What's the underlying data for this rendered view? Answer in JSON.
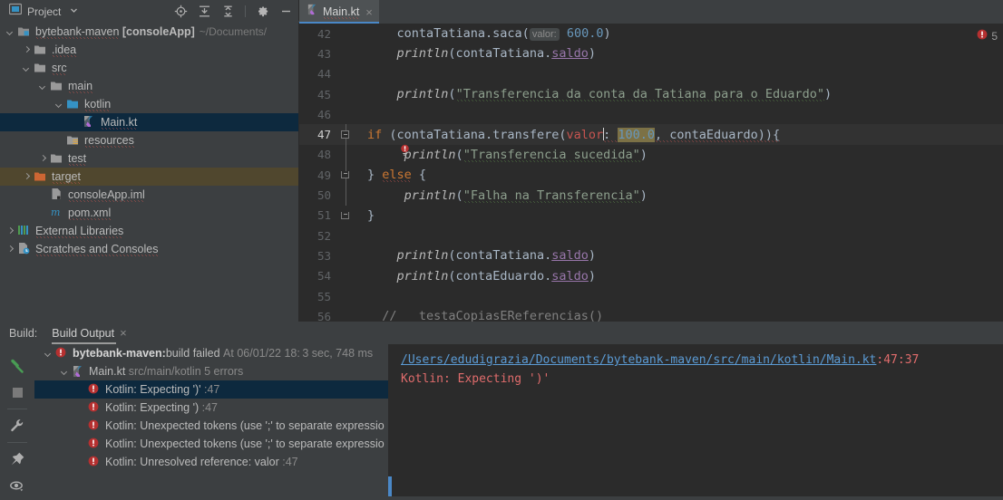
{
  "project_panel": {
    "title": "Project",
    "icons": [
      "project-window-icon",
      "locate-icon",
      "expand-all-icon",
      "collapse-all-icon",
      "settings-gear-icon",
      "minimize-icon"
    ],
    "tree": [
      {
        "indent": 0,
        "arrow": "down",
        "icon": "module-icon",
        "label": "bytebank-maven",
        "bold_suffix": "[consoleApp]",
        "dim": "~/Documents/",
        "state": "normal"
      },
      {
        "indent": 1,
        "arrow": "right",
        "icon": "folder-icon",
        "label": ".idea",
        "bold_suffix": "",
        "dim": "",
        "state": "normal"
      },
      {
        "indent": 1,
        "arrow": "down",
        "icon": "folder-icon",
        "label": "src",
        "bold_suffix": "",
        "dim": "",
        "state": "normal"
      },
      {
        "indent": 2,
        "arrow": "down",
        "icon": "folder-icon",
        "label": "main",
        "bold_suffix": "",
        "dim": "",
        "state": "normal"
      },
      {
        "indent": 3,
        "arrow": "down",
        "icon": "source-root-icon",
        "label": "kotlin",
        "bold_suffix": "",
        "dim": "",
        "state": "normal"
      },
      {
        "indent": 4,
        "arrow": "none",
        "icon": "kotlin-file-icon",
        "label": "Main.kt",
        "bold_suffix": "",
        "dim": "",
        "state": "selected"
      },
      {
        "indent": 3,
        "arrow": "none",
        "icon": "resources-icon",
        "label": "resources",
        "bold_suffix": "",
        "dim": "",
        "state": "normal"
      },
      {
        "indent": 2,
        "arrow": "right",
        "icon": "folder-icon",
        "label": "test",
        "bold_suffix": "",
        "dim": "",
        "state": "normal"
      },
      {
        "indent": 1,
        "arrow": "right",
        "icon": "excluded-folder-icon",
        "label": "target",
        "bold_suffix": "",
        "dim": "",
        "state": "excluded"
      },
      {
        "indent": 2,
        "arrow": "none",
        "icon": "iml-file-icon",
        "label": "consoleApp.iml",
        "bold_suffix": "",
        "dim": "",
        "state": "normal"
      },
      {
        "indent": 2,
        "arrow": "none",
        "icon": "maven-icon",
        "label": "pom.xml",
        "bold_suffix": "",
        "dim": "",
        "state": "normal"
      },
      {
        "indent": 0,
        "arrow": "right",
        "icon": "libraries-icon",
        "label": "External Libraries",
        "bold_suffix": "",
        "dim": "",
        "state": "normal"
      },
      {
        "indent": 0,
        "arrow": "right",
        "icon": "scratches-icon",
        "label": "Scratches and Consoles",
        "bold_suffix": "",
        "dim": "",
        "state": "normal"
      }
    ]
  },
  "editor": {
    "tab": {
      "label": "Main.kt",
      "icon": "kotlin-file-icon",
      "close": "×"
    },
    "error_badge": {
      "icon": "error-icon",
      "count": "5"
    },
    "lines": [
      {
        "n": "42"
      },
      {
        "n": "43"
      },
      {
        "n": "44"
      },
      {
        "n": "45"
      },
      {
        "n": "46"
      },
      {
        "n": "47"
      },
      {
        "n": "48"
      },
      {
        "n": "49"
      },
      {
        "n": "50"
      },
      {
        "n": "51"
      },
      {
        "n": "52"
      },
      {
        "n": "53"
      },
      {
        "n": "54"
      },
      {
        "n": "55"
      },
      {
        "n": "56"
      }
    ],
    "code": {
      "l42_call": "contaTatiana.saca(",
      "l42_hint": "valor:",
      "l42_num": "600.0",
      "l42_close": ")",
      "l43_fn": "println",
      "l43_open": "(contaTatiana.",
      "l43_prop": "saldo",
      "l43_close": ")",
      "l45_fn": "println",
      "l45_open": "(",
      "l45_str": "\"Transferencia da conta da Tatiana para o Eduardo\"",
      "l45_close": ")",
      "l47_kw": "if",
      "l47_a": " (contaTatiana.transfere(",
      "l47_err": "valor",
      "l47_b": ": ",
      "l47_num": "100.0",
      "l47_c": ", contaEduardo)){",
      "l48_fn": "println",
      "l48_open": "(",
      "l48_str": "\"Transferencia sucedida\"",
      "l48_close": ")",
      "l49_a": "} ",
      "l49_kw": "else",
      "l49_b": " {",
      "l50_fn": "println",
      "l50_open": "(",
      "l50_str": "\"Falha na Transferencia\"",
      "l50_close": ")",
      "l51_a": "}",
      "l53_fn": "println",
      "l53_open": "(contaTatiana.",
      "l53_prop": "saldo",
      "l53_close": ")",
      "l54_fn": "println",
      "l54_open": "(contaEduardo.",
      "l54_prop": "saldo",
      "l54_close": ")",
      "l56_cmt_a": "//",
      "l56_cmt_b": "   testaCopiasEReferencias()"
    }
  },
  "build_panel": {
    "label": "Build:",
    "tab": {
      "label": "Build Output",
      "close": "×"
    },
    "side_icons": [
      "build-hammer-icon",
      "stop-icon",
      "toggle-settings-wrench-icon",
      "pin-icon",
      "show-hide-eye-icon"
    ],
    "tree": [
      {
        "indent": 0,
        "arrow": "down",
        "icon": "error-icon",
        "bold": "bytebank-maven:",
        "text": " build failed",
        "dim": "At 06/01/22 18: ",
        "dim2": "3 sec, 748 ms",
        "state": "normal"
      },
      {
        "indent": 1,
        "arrow": "down",
        "icon": "kotlin-file-icon",
        "bold": "",
        "text": "Main.kt",
        "dim": "src/main/kotlin 5 errors",
        "dim2": "",
        "state": "normal"
      },
      {
        "indent": 2,
        "arrow": "none",
        "icon": "error-icon",
        "bold": "",
        "text": "Kotlin: Expecting ')'",
        "dim": ":47",
        "dim2": "",
        "state": "selected"
      },
      {
        "indent": 2,
        "arrow": "none",
        "icon": "error-icon",
        "bold": "",
        "text": "Kotlin: Expecting ')",
        "dim": ":47",
        "dim2": "",
        "state": "normal"
      },
      {
        "indent": 2,
        "arrow": "none",
        "icon": "error-icon",
        "bold": "",
        "text": "Kotlin: Unexpected tokens (use ';' to separate expressio",
        "dim": "",
        "dim2": "",
        "state": "normal"
      },
      {
        "indent": 2,
        "arrow": "none",
        "icon": "error-icon",
        "bold": "",
        "text": "Kotlin: Unexpected tokens (use ';' to separate expressio",
        "dim": "",
        "dim2": "",
        "state": "normal"
      },
      {
        "indent": 2,
        "arrow": "none",
        "icon": "error-icon",
        "bold": "",
        "text": "Kotlin: Unresolved reference: valor",
        "dim": ":47",
        "dim2": "",
        "state": "normal"
      }
    ],
    "detail": {
      "path": "/Users/edudigrazia/Documents/bytebank-maven/src/main/kotlin/Main.kt",
      "location": ":47:37",
      "message": "Kotlin: Expecting ')'"
    }
  }
}
